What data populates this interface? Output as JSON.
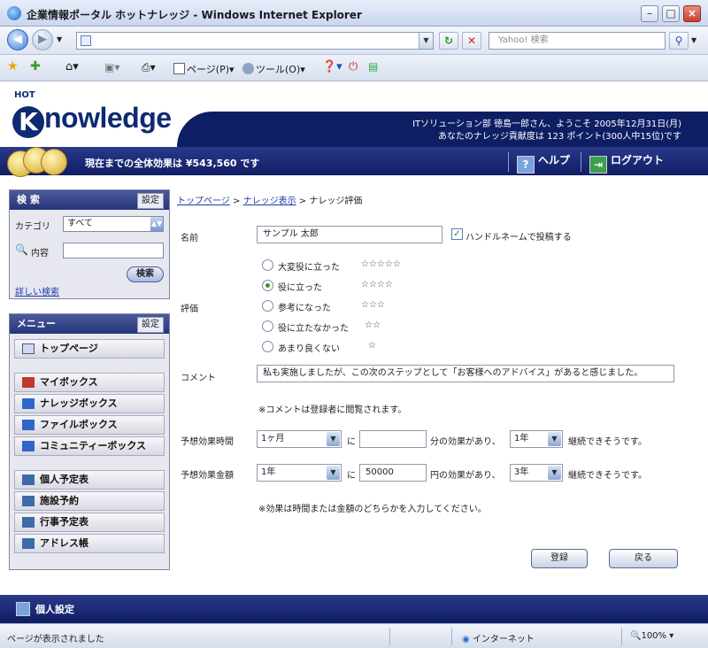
{
  "window": {
    "title": "企業情報ポータル ホットナレッジ - Windows Internet Explorer",
    "minimize": "–",
    "maximize": "□",
    "close": "×"
  },
  "address_bar": {
    "url": "",
    "search_placeholder": "Yahoo! 検索",
    "go_icon": "refresh-icon",
    "stop_icon": "stop-icon"
  },
  "command_bar": {
    "page": "ページ(P)",
    "tools": "ツール(O)"
  },
  "header": {
    "logo_hot": "HOT",
    "logo_k": "K",
    "logo_text": "nowledge",
    "user_line1": "ITソリューション部  徳島一郎さん、ようこそ   2005年12月31日(月)",
    "user_line2": "あなたのナレッジ貢献度は 123 ポイント(300人中15位)です",
    "effect_total": "現在までの全体効果は ¥543,560 です",
    "help": "ヘルプ",
    "logout": "ログアウト"
  },
  "sidebar": {
    "search": {
      "title": "検 索",
      "setting": "設定",
      "category_label": "カテゴリ",
      "category_value": "すべて",
      "content_label": "内容",
      "content_value": "",
      "search_button": "検索",
      "advanced_link": "詳しい検索"
    },
    "menu": {
      "title": "メニュー",
      "setting": "設定",
      "items": [
        "トップページ",
        "マイボックス",
        "ナレッジボックス",
        "ファイルボックス",
        "コミュニティーボックス",
        "個人予定表",
        "施設予約",
        "行事予定表",
        "アドレス帳"
      ]
    }
  },
  "breadcrumb": {
    "top": "トップページ",
    "view": "ナレッジ表示",
    "current": "ナレッジ評価",
    "sep": ">"
  },
  "form": {
    "name_label": "名前",
    "name_value": "サンプル 太郎",
    "handle_checkbox_label": "ハンドルネームで投稿する",
    "handle_checked": true,
    "rating_label": "評価",
    "ratings": [
      {
        "label": "大変役に立った",
        "stars": "☆☆☆☆☆",
        "selected": false
      },
      {
        "label": "役に立った",
        "stars": "☆☆☆☆",
        "selected": true
      },
      {
        "label": "参考になった",
        "stars": "☆☆☆",
        "selected": false
      },
      {
        "label": "役に立たなかった",
        "stars": "☆☆",
        "selected": false
      },
      {
        "label": "あまり良くない",
        "stars": "☆",
        "selected": false
      }
    ],
    "comment_label": "コメント",
    "comment_value": "私も実施しましたが、この次のステップとして「お客様へのアドバイス」があると感じました。",
    "comment_note": "※コメントは登録者に閲覧されます。",
    "time_label": "予想効果時間",
    "time_period": "1ヶ月",
    "time_ni": "に",
    "time_value": "",
    "time_mid": "分の効果があり、",
    "time_years": "1年",
    "time_end": "継続できそうです。",
    "money_label": "予想効果金額",
    "money_period": "1年",
    "money_ni": "に",
    "money_value": "50000",
    "money_mid": "円の効果があり、",
    "money_years": "3年",
    "money_end": "継続できそうです。",
    "effect_note": "※効果は時間または金額のどちらかを入力してください。",
    "submit": "登録",
    "back": "戻る"
  },
  "footer": {
    "personal_settings": "個人設定"
  },
  "status_bar": {
    "text": "ページが表示されました",
    "zone": "インターネット",
    "zoom": "100%"
  }
}
